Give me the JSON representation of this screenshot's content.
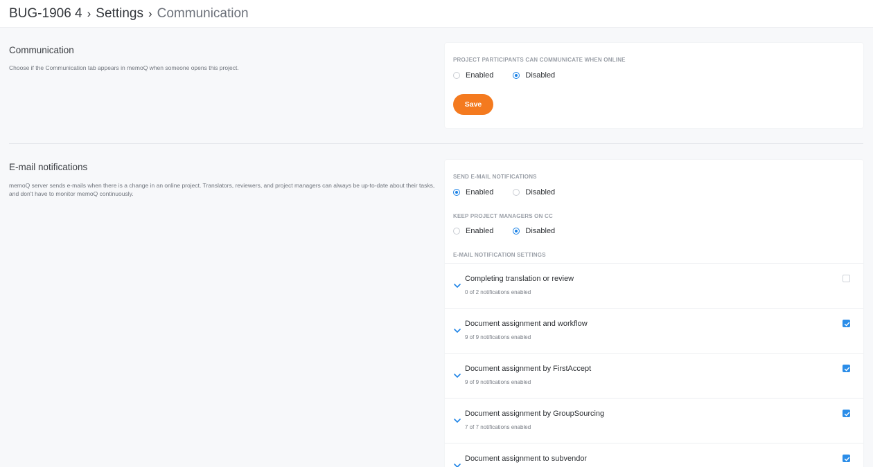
{
  "breadcrumb": {
    "project": "BUG-1906 4",
    "settings": "Settings",
    "current": "Communication",
    "separator": "›"
  },
  "communication": {
    "title": "Communication",
    "description": "Choose if the Communication tab appears in memoQ when someone opens this project.",
    "field_label": "PROJECT PARTICIPANTS CAN COMMUNICATE WHEN ONLINE",
    "options": [
      "Enabled",
      "Disabled"
    ],
    "selected": "Disabled",
    "save_label": "Save"
  },
  "email": {
    "title": "E-mail notifications",
    "description": "memoQ server sends e-mails when there is a change in an online project. Translators, reviewers, and project managers can always be up-to-date about their tasks, and don't have to monitor memoQ continuously.",
    "send_label": "SEND E-MAIL NOTIFICATIONS",
    "send_options": [
      "Enabled",
      "Disabled"
    ],
    "send_selected": "Enabled",
    "cc_label": "KEEP PROJECT MANAGERS ON CC",
    "cc_options": [
      "Enabled",
      "Disabled"
    ],
    "cc_selected": "Disabled",
    "settings_label": "E-MAIL NOTIFICATION SETTINGS",
    "notifications": [
      {
        "title": "Completing translation or review",
        "subtitle": "0 of 2 notifications enabled",
        "checked": false
      },
      {
        "title": "Document assignment and workflow",
        "subtitle": "9 of 9 notifications enabled",
        "checked": true
      },
      {
        "title": "Document assignment by FirstAccept",
        "subtitle": "9 of 9 notifications enabled",
        "checked": true
      },
      {
        "title": "Document assignment by GroupSourcing",
        "subtitle": "7 of 7 notifications enabled",
        "checked": true
      },
      {
        "title": "Document assignment to subvendor",
        "subtitle": "",
        "checked": true
      }
    ]
  },
  "colors": {
    "accent": "#f47a1f",
    "radio_selected": "#1b82e6",
    "checkbox_checked": "#2b8de8"
  },
  "icons": {
    "chevron": "chevron-down-icon",
    "checkbox": "checkbox-icon"
  }
}
